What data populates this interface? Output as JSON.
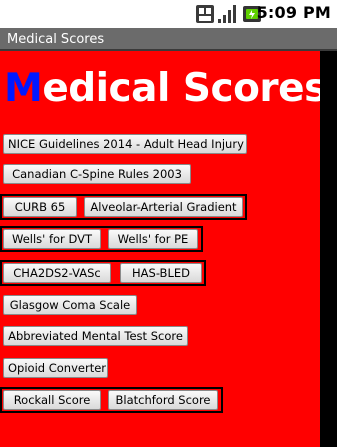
{
  "status_bar": {
    "time": "5:09 PM",
    "icons": [
      "storage-icon",
      "signal-icon",
      "battery-icon"
    ]
  },
  "window": {
    "title": "Medical Scores"
  },
  "page": {
    "heading_first": "M",
    "heading_rest": "edical Scores"
  },
  "buttons": {
    "nice": "NICE Guidelines 2014 - Adult Head Injury",
    "cspine": "Canadian C-Spine Rules 2003",
    "curb65": "CURB 65",
    "aa_gradient": "Alveolar-Arterial Gradient",
    "wells_dvt": "Wells' for DVT",
    "wells_pe": "Wells' for PE",
    "cha2ds2": "CHA2DS2-VASc",
    "hasbled": "HAS-BLED",
    "gcs": "Glasgow Coma Scale",
    "amts": "Abbreviated Mental Test Score",
    "opioid": "Opioid Converter",
    "rockall": "Rockall Score",
    "blatchford": "Blatchford Score"
  },
  "colors": {
    "background": "#ff0000",
    "heading_accent": "#0019ff",
    "heading_text": "#ffffff",
    "title_bar": "#6b6b6b"
  }
}
